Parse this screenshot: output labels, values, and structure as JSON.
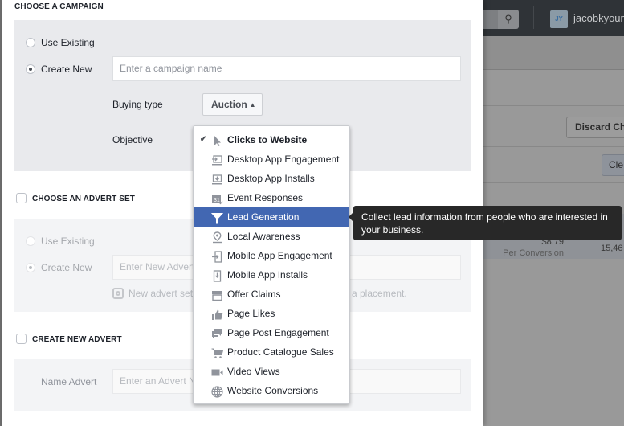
{
  "background": {
    "username": "jacobkyoung",
    "avatar_initials": "JY",
    "discard_label": "Discard Ch",
    "clear_label": "Cle",
    "cost_value": "$8.79",
    "cost_label": "Per Conversion",
    "reach_value": "15,46"
  },
  "dialog": {
    "campaign": {
      "title": "CHOOSE A CAMPAIGN",
      "use_existing": "Use Existing",
      "create_new": "Create New",
      "name_placeholder": "Enter a campaign name",
      "buying_type_label": "Buying type",
      "buying_type_value": "Auction",
      "objective_label": "Objective"
    },
    "advert_set": {
      "title": "CHOOSE AN ADVERT SET",
      "use_existing": "Use Existing",
      "create_new": "Create New",
      "name_placeholder": "Enter New Advert Set Name",
      "hint_left": "New advert set",
      "hint_right": "a placement."
    },
    "advert": {
      "title": "CREATE NEW ADVERT",
      "name_label": "Name Advert",
      "name_placeholder": "Enter an Advert Name"
    }
  },
  "objective_menu": {
    "selected": "Clicks to Website",
    "highlighted": "Lead Generation",
    "items": [
      {
        "label": "Clicks to Website",
        "icon": "cursor-icon"
      },
      {
        "label": "Desktop App Engagement",
        "icon": "desktop-app-engagement-icon"
      },
      {
        "label": "Desktop App Installs",
        "icon": "desktop-app-install-icon"
      },
      {
        "label": "Event Responses",
        "icon": "calendar-icon"
      },
      {
        "label": "Lead Generation",
        "icon": "funnel-icon"
      },
      {
        "label": "Local Awareness",
        "icon": "location-pin-icon"
      },
      {
        "label": "Mobile App Engagement",
        "icon": "mobile-app-engagement-icon"
      },
      {
        "label": "Mobile App Installs",
        "icon": "mobile-app-install-icon"
      },
      {
        "label": "Offer Claims",
        "icon": "storefront-icon"
      },
      {
        "label": "Page Likes",
        "icon": "thumbs-up-icon"
      },
      {
        "label": "Page Post Engagement",
        "icon": "speech-bubbles-icon"
      },
      {
        "label": "Product Catalogue Sales",
        "icon": "shopping-cart-icon"
      },
      {
        "label": "Video Views",
        "icon": "video-camera-icon"
      },
      {
        "label": "Website Conversions",
        "icon": "globe-icon"
      }
    ]
  },
  "tooltip": {
    "text": "Collect lead information from people who are interested in your business."
  }
}
